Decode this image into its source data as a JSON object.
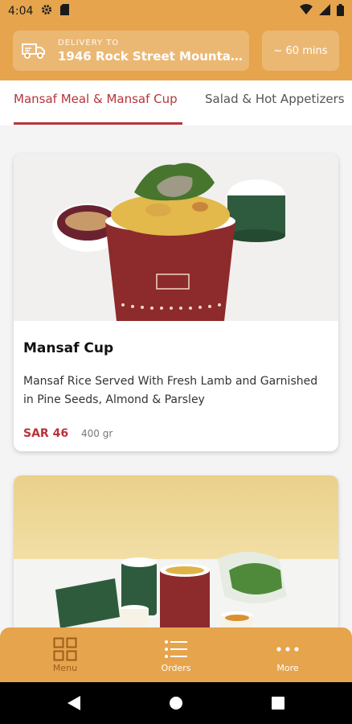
{
  "status_bar": {
    "time": "4:04"
  },
  "header": {
    "delivery_label": "DELIVERY TO",
    "delivery_address": "1946 Rock Street Mountain ...",
    "eta": "~ 60 mins"
  },
  "tabs": [
    {
      "label": "Mansaf Meal & Mansaf Cup",
      "active": true
    },
    {
      "label": "Salad & Hot Appetizers",
      "active": false
    }
  ],
  "products": [
    {
      "title": "Mansaf Cup",
      "description": "Mansaf Rice Served With Fresh Lamb and Garnished in Pine Seeds, Almond & Parsley",
      "price": "SAR 46",
      "weight": "400 gr"
    }
  ],
  "bottom_nav": [
    {
      "label": "Menu",
      "icon": "grid-icon",
      "active": true
    },
    {
      "label": "Orders",
      "icon": "list-icon",
      "active": false
    },
    {
      "label": "More",
      "icon": "more-dots-icon",
      "active": false
    }
  ],
  "colors": {
    "brand_orange": "#e6a44d",
    "accent_red": "#b7343a",
    "nav_active": "#9e5e1c"
  }
}
